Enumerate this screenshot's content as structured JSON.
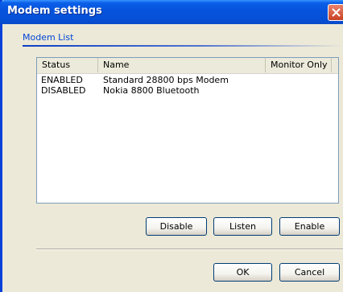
{
  "window": {
    "title": "Modem settings"
  },
  "section": {
    "label": "Modem List"
  },
  "list": {
    "columns": [
      "Status",
      "Name",
      "Monitor Only"
    ],
    "rows": [
      {
        "status": "ENABLED",
        "name": "Standard 28800 bps Modem",
        "monitor_only": ""
      },
      {
        "status": "DISABLED",
        "name": "Nokia 8800 Bluetooth",
        "monitor_only": ""
      }
    ]
  },
  "buttons": {
    "disable": "Disable",
    "listen": "Listen",
    "enable": "Enable",
    "ok": "OK",
    "cancel": "Cancel"
  },
  "colors": {
    "titlebar": "#0653dc",
    "dialog_bg": "#ece9d8",
    "section_label": "#0046d5",
    "close_button": "#d4522f"
  },
  "icons": {
    "close": "close-icon"
  }
}
